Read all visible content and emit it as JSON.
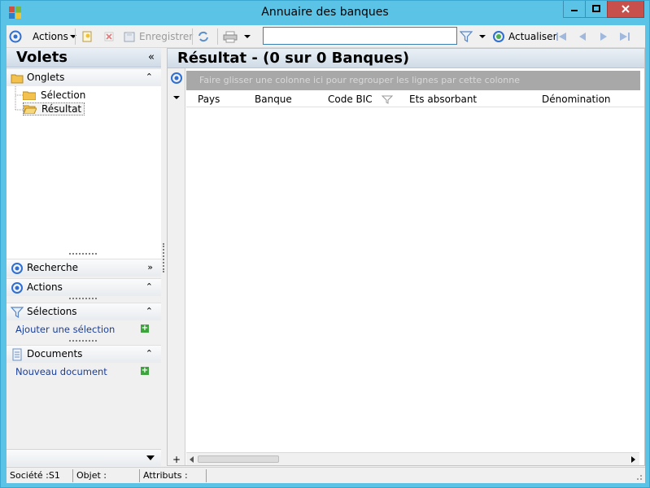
{
  "window": {
    "title": "Annuaire des banques"
  },
  "toolbar": {
    "actions_label": "Actions",
    "save_label": "Enregistrer",
    "search_value": "",
    "refresh_label": "Actualiser"
  },
  "left": {
    "header": "Volets",
    "onglets": {
      "title": "Onglets",
      "items": [
        "Sélection",
        "Résultat"
      ]
    },
    "recherche": {
      "title": "Recherche"
    },
    "actions": {
      "title": "Actions"
    },
    "selections": {
      "title": "Sélections",
      "link": "Ajouter une sélection"
    },
    "documents": {
      "title": "Documents",
      "link": "Nouveau document"
    }
  },
  "result": {
    "title": "Résultat - (0 sur 0 Banques)",
    "group_hint": "Faire glisser une colonne ici pour regrouper les lignes par cette colonne",
    "columns": [
      "Pays",
      "Banque",
      "Code BIC",
      "Ets absorbant",
      "Dénomination"
    ]
  },
  "status": {
    "societe": "Société :S1",
    "objet": "Objet :",
    "attributs": "Attributs :"
  },
  "colors": {
    "accent": "#5bc4e6",
    "link": "#1a3f9a",
    "close": "#c7504d"
  }
}
